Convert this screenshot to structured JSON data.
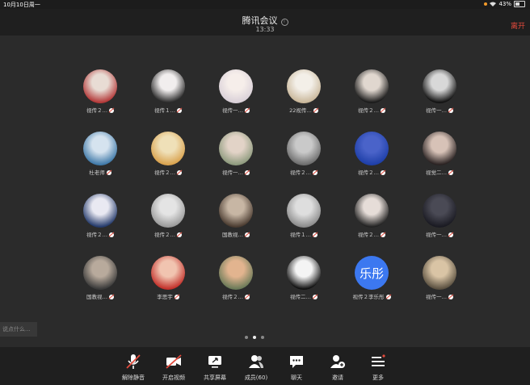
{
  "statusbar": {
    "time": "10月10日周一",
    "battery": "43%"
  },
  "header": {
    "title": "腾讯会议",
    "info": "i",
    "clock": "13:33",
    "leave": "离开"
  },
  "participants": [
    {
      "name": "视传２…",
      "c1": "#b33838",
      "c2": "#e8dcd4"
    },
    {
      "name": "视传１…",
      "c1": "#2a2a2a",
      "c2": "#f1eeee"
    },
    {
      "name": "视传一…",
      "c1": "#d9d0d8",
      "c2": "#f6eeea"
    },
    {
      "name": "22视传…",
      "c1": "#c9b79a",
      "c2": "#f3efe8"
    },
    {
      "name": "视传２…",
      "c1": "#1a1a1a",
      "c2": "#e0d7cf"
    },
    {
      "name": "视传一…",
      "c1": "#111111",
      "c2": "#d8d8d8"
    },
    {
      "name": "杜老师",
      "c1": "#3f79a8",
      "c2": "#d5e3ef"
    },
    {
      "name": "视传２…",
      "c1": "#d9a24e",
      "c2": "#efe0b8"
    },
    {
      "name": "视传一…",
      "c1": "#8d9a7d",
      "c2": "#e2d3c7"
    },
    {
      "name": "视传２…",
      "c1": "#6d6d6d",
      "c2": "#c9c9c9"
    },
    {
      "name": "视传２…",
      "c1": "#1e3fa8",
      "c2": "#4a63c9"
    },
    {
      "name": "视觉二…",
      "c1": "#2a2222",
      "c2": "#d7c2b7"
    },
    {
      "name": "视传２…",
      "c1": "#243a6b",
      "c2": "#e9e9f2"
    },
    {
      "name": "视传２…",
      "c1": "#9a9a9a",
      "c2": "#e4e4e4"
    },
    {
      "name": "国教视…",
      "c1": "#4a3b30",
      "c2": "#c7b6a4"
    },
    {
      "name": "视传１…",
      "c1": "#8b8b8b",
      "c2": "#dedede"
    },
    {
      "name": "视传２…",
      "c1": "#222222",
      "c2": "#e6ddd8"
    },
    {
      "name": "视传一…",
      "c1": "#1a1a22",
      "c2": "#4a4a55"
    },
    {
      "name": "国教视…",
      "c1": "#3a3a3a",
      "c2": "#b8aa9c"
    },
    {
      "name": "李思宇",
      "c1": "#c2302a",
      "c2": "#f1c4b0"
    },
    {
      "name": "视传２…",
      "c1": "#6a7a58",
      "c2": "#e2b48f"
    },
    {
      "name": "视传二…",
      "c1": "#111111",
      "c2": "#f4f4f4"
    },
    {
      "name": "视传２李乐彤",
      "text": "乐彤"
    },
    {
      "name": "视传一…",
      "c1": "#5a5040",
      "c2": "#d9c4a5"
    }
  ],
  "chat": {
    "placeholder": "说点什么..."
  },
  "toolbar": [
    {
      "label": "解除静音",
      "icon": "mic-muted-icon"
    },
    {
      "label": "开启视频",
      "icon": "video-off-icon"
    },
    {
      "label": "共享屏幕",
      "icon": "share-screen-icon"
    },
    {
      "label": "成员(60)",
      "icon": "members-icon"
    },
    {
      "label": "聊天",
      "icon": "chat-icon"
    },
    {
      "label": "邀请",
      "icon": "invite-icon"
    },
    {
      "label": "更多",
      "icon": "more-icon"
    }
  ],
  "colors": {
    "accent": "#3c78f0",
    "leave": "#e34a3c",
    "background": "#2b2b2b",
    "bar": "#1f1f1f"
  }
}
